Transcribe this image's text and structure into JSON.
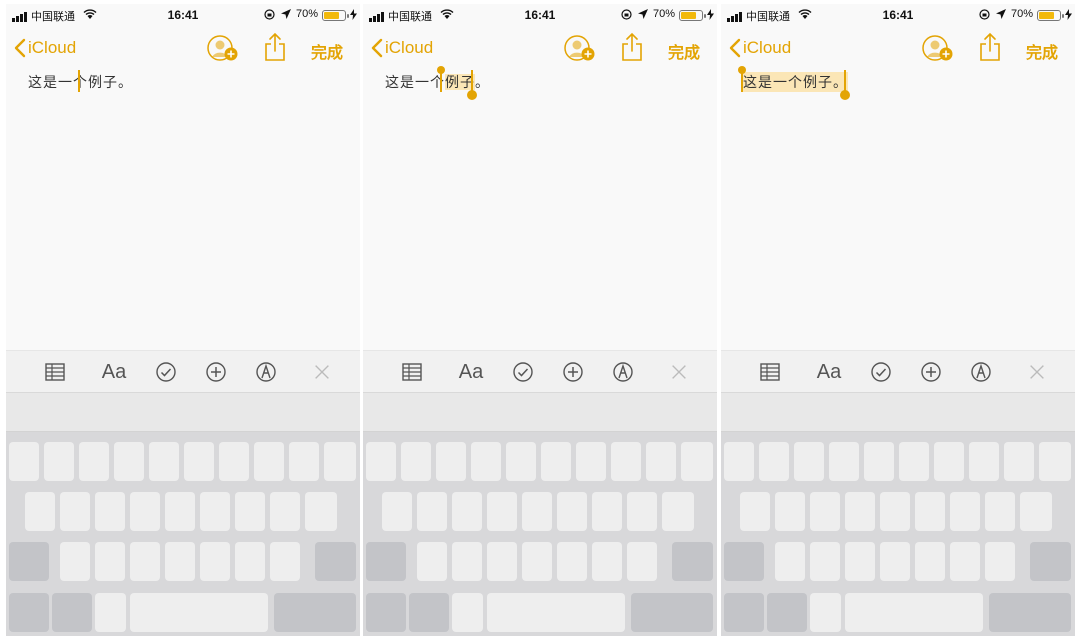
{
  "colors": {
    "accent": "#e3a404",
    "selection": "#fbe6b6"
  },
  "panels": [
    {
      "status": {
        "carrier": "中国联通",
        "time": "16:41",
        "battery": "70%"
      },
      "nav": {
        "back_label": "iCloud",
        "done_label": "完成"
      },
      "note": {
        "seg1": "这是一",
        "seg2": "个",
        "seg3": "例子",
        "seg4": "。"
      },
      "selection": "caret",
      "toolbar": {
        "format_label": "Aa"
      }
    },
    {
      "status": {
        "carrier": "中国联通",
        "time": "16:41",
        "battery": "70%"
      },
      "nav": {
        "back_label": "iCloud",
        "done_label": "完成"
      },
      "note": {
        "seg1": "这是一",
        "seg2": "个",
        "seg3": "例子",
        "seg4": "。"
      },
      "selection": "例子",
      "toolbar": {
        "format_label": "Aa"
      }
    },
    {
      "status": {
        "carrier": "中国联通",
        "time": "16:41",
        "battery": "70%"
      },
      "nav": {
        "back_label": "iCloud",
        "done_label": "完成"
      },
      "note": {
        "seg1": "这是一",
        "seg2": "个",
        "seg3": "例子",
        "seg4": "。"
      },
      "selection": "这是一个例子。",
      "toolbar": {
        "format_label": "Aa"
      }
    }
  ],
  "icons": [
    "table-icon",
    "checklist-icon",
    "add-icon",
    "markup-icon",
    "close-icon",
    "add-person-icon",
    "share-icon",
    "back-chevron-icon",
    "wifi-icon",
    "battery-icon"
  ]
}
